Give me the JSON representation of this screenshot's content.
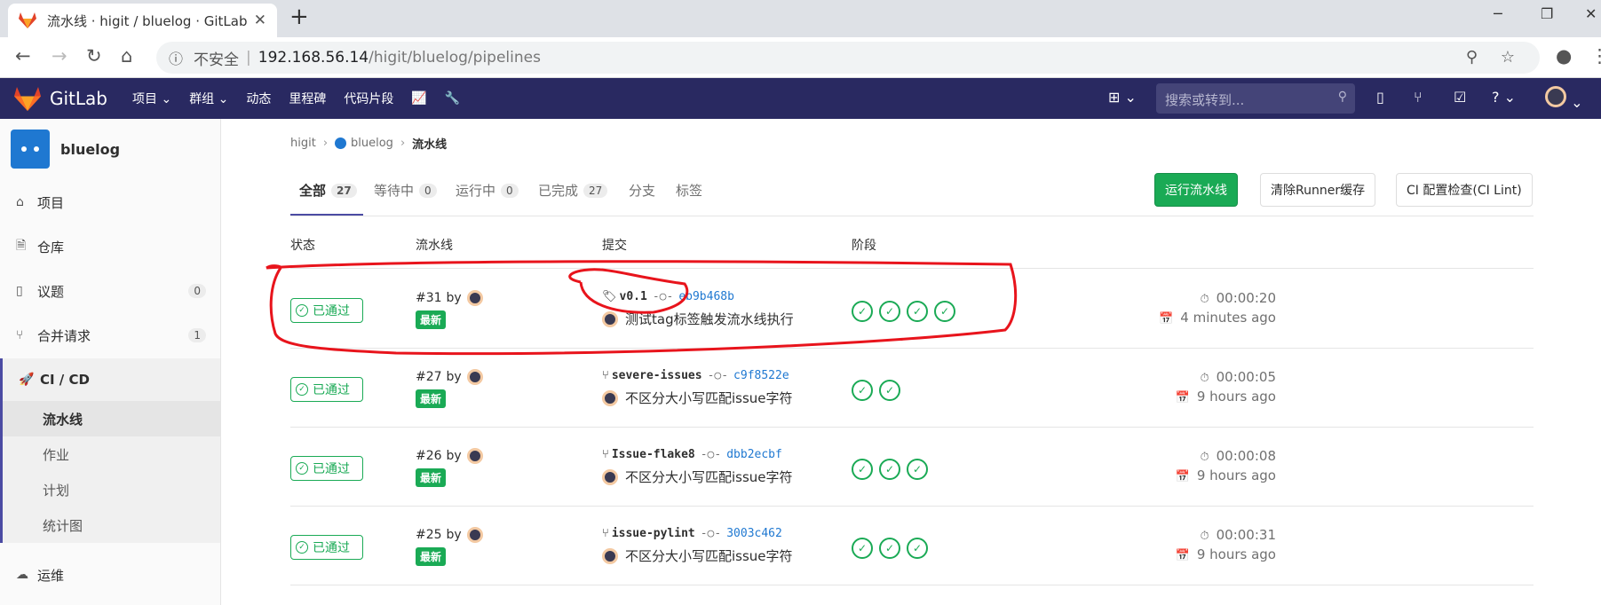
{
  "browser": {
    "tab_title": "流水线 · higit / bluelog · GitLab",
    "newtab": "+",
    "insecure": "不安全",
    "url_host": "192.168.56.14",
    "url_path": "/higit/bluelog/pipelines"
  },
  "header": {
    "brand": "GitLab",
    "nav": [
      "项目 ⌄",
      "群组 ⌄",
      "动态",
      "里程碑",
      "代码片段"
    ],
    "search_placeholder": "搜索或转到..."
  },
  "sidebar": {
    "project_name": "bluelog",
    "items": [
      {
        "label": "项目",
        "icon": "home-icon",
        "count": ""
      },
      {
        "label": "仓库",
        "icon": "doc-icon",
        "count": ""
      },
      {
        "label": "议题",
        "icon": "issues-icon",
        "count": "0"
      },
      {
        "label": "合并请求",
        "icon": "merge-icon",
        "count": "1"
      },
      {
        "label": "CI / CD",
        "icon": "rocket-icon",
        "count": ""
      }
    ],
    "cicd_sub": [
      "流水线",
      "作业",
      "计划",
      "统计图"
    ],
    "ops": "运维"
  },
  "breadcrumb": [
    "higit",
    "bluelog",
    "流水线"
  ],
  "tabs": [
    {
      "label": "全部",
      "count": "27"
    },
    {
      "label": "等待中",
      "count": "0"
    },
    {
      "label": "运行中",
      "count": "0"
    },
    {
      "label": "已完成",
      "count": "27"
    },
    {
      "label": "分支",
      "count": ""
    },
    {
      "label": "标签",
      "count": ""
    }
  ],
  "buttons": {
    "run": "运行流水线",
    "clear_cache": "清除Runner缓存",
    "ci_lint": "CI 配置检查(CI Lint)"
  },
  "columns": [
    "状态",
    "流水线",
    "提交",
    "阶段"
  ],
  "pipelines": [
    {
      "status": "已通过",
      "id": "#31",
      "by": "by",
      "latest": "最新",
      "ref_type": "tag",
      "ref": "v0.1",
      "sha": "eb9b468b",
      "message": "测试tag标签触发流水线执行",
      "stages": 4,
      "duration": "00:00:20",
      "ago": "4 minutes ago"
    },
    {
      "status": "已通过",
      "id": "#27",
      "by": "by",
      "latest": "最新",
      "ref_type": "branch",
      "ref": "severe-issues",
      "sha": "c9f8522e",
      "message": "不区分大小写匹配issue字符",
      "stages": 2,
      "duration": "00:00:05",
      "ago": "9 hours ago"
    },
    {
      "status": "已通过",
      "id": "#26",
      "by": "by",
      "latest": "最新",
      "ref_type": "branch",
      "ref": "Issue-flake8",
      "sha": "dbb2ecbf",
      "message": "不区分大小写匹配issue字符",
      "stages": 3,
      "duration": "00:00:08",
      "ago": "9 hours ago"
    },
    {
      "status": "已通过",
      "id": "#25",
      "by": "by",
      "latest": "最新",
      "ref_type": "branch",
      "ref": "issue-pylint",
      "sha": "3003c462",
      "message": "不区分大小写匹配issue字符",
      "stages": 3,
      "duration": "00:00:31",
      "ago": "9 hours ago"
    }
  ],
  "colors": {
    "header": "#292961",
    "success": "#1aaa55",
    "link": "#1f78d1",
    "annotation": "#e8141c"
  }
}
